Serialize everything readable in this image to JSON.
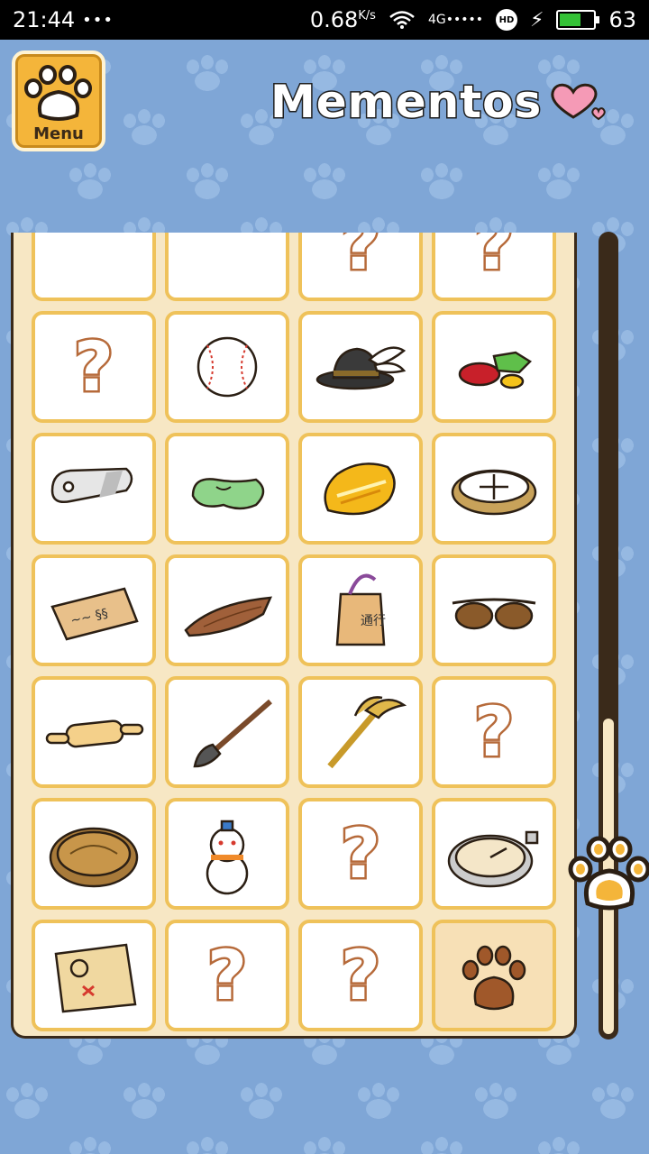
{
  "status_bar": {
    "time": "21:44",
    "dots": "•••",
    "speed": "0.68",
    "speed_unit": "K/s",
    "signal": "4G•••••",
    "hd": "HD",
    "battery": "63",
    "battery_level": 0.63,
    "battery_color": "#34c236"
  },
  "header": {
    "menu_label": "Menu",
    "title": "Mementos"
  },
  "colors": {
    "background": "#7fa6d6",
    "panel": "#f7e7c4",
    "cell_border": "#efc25a",
    "unknown_mark": "#b66a3a"
  },
  "grid": {
    "items": [
      {
        "icon": "red-brooch-icon"
      },
      {
        "icon": "teal-fish-tray-icon"
      },
      {
        "icon": "unknown-item-icon",
        "mark": "?"
      },
      {
        "icon": "unknown-item-icon",
        "mark": "?"
      },
      {
        "icon": "unknown-item-icon",
        "mark": "?"
      },
      {
        "icon": "baseball-icon"
      },
      {
        "icon": "feathered-hat-icon"
      },
      {
        "icon": "jewels-icon"
      },
      {
        "icon": "silver-dog-tag-icon"
      },
      {
        "icon": "green-stone-icon"
      },
      {
        "icon": "gold-coin-icon"
      },
      {
        "icon": "compass-ring-icon"
      },
      {
        "icon": "graffiti-note-icon"
      },
      {
        "icon": "wooden-plank-icon"
      },
      {
        "icon": "wooden-pass-tag-icon"
      },
      {
        "icon": "sunglasses-icon"
      },
      {
        "icon": "rolling-pin-icon"
      },
      {
        "icon": "calligraphy-brush-icon"
      },
      {
        "icon": "golden-staff-icon"
      },
      {
        "icon": "unknown-item-icon",
        "mark": "?"
      },
      {
        "icon": "bronze-medallion-icon"
      },
      {
        "icon": "snowman-icon"
      },
      {
        "icon": "unknown-item-icon",
        "mark": "?"
      },
      {
        "icon": "pocket-watch-icon"
      },
      {
        "icon": "treasure-map-icon"
      },
      {
        "icon": "unknown-item-icon",
        "mark": "?"
      },
      {
        "icon": "unknown-item-icon",
        "mark": "?"
      },
      {
        "icon": "paw-print-icon"
      }
    ]
  },
  "scroll": {
    "position_fraction": 0.85
  }
}
